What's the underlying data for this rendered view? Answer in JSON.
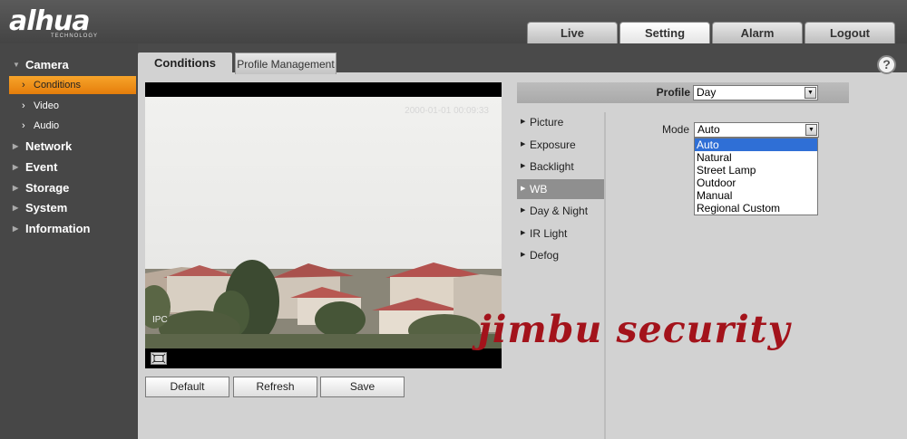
{
  "brand": {
    "name": "alhua",
    "sub": "TECHNOLOGY"
  },
  "topnav": {
    "tabs": [
      {
        "label": "Live"
      },
      {
        "label": "Setting"
      },
      {
        "label": "Alarm"
      },
      {
        "label": "Logout"
      }
    ],
    "active": "Setting"
  },
  "sidebar": {
    "camera": "Camera",
    "camera_items": [
      {
        "label": "Conditions"
      },
      {
        "label": "Video"
      },
      {
        "label": "Audio"
      }
    ],
    "sections": [
      {
        "label": "Network"
      },
      {
        "label": "Event"
      },
      {
        "label": "Storage"
      },
      {
        "label": "System"
      },
      {
        "label": "Information"
      }
    ]
  },
  "subtabs": {
    "active": "Conditions",
    "other": "Profile Management"
  },
  "help": "?",
  "video": {
    "timestamp": "2000-01-01 00:09:33",
    "osd": "IPC"
  },
  "buttons": {
    "default": "Default",
    "refresh": "Refresh",
    "save": "Save"
  },
  "profile": {
    "label": "Profile",
    "value": "Day"
  },
  "menu": {
    "items": [
      {
        "label": "Picture"
      },
      {
        "label": "Exposure"
      },
      {
        "label": "Backlight"
      },
      {
        "label": "WB"
      },
      {
        "label": "Day & Night"
      },
      {
        "label": "IR Light"
      },
      {
        "label": "Defog"
      }
    ],
    "active": "WB"
  },
  "mode": {
    "label": "Mode",
    "value": "Auto",
    "options": [
      "Auto",
      "Natural",
      "Street Lamp",
      "Outdoor",
      "Manual",
      "Regional Custom"
    ]
  },
  "watermark": "jimbu security",
  "icons": {
    "fullscreen": "fullscreen-icon",
    "help": "help-icon",
    "dropdown": "chevron-down-icon"
  },
  "colors": {
    "accent": "#f29418",
    "menu_active": "#8f8f8f",
    "watermark": "#a3131b",
    "select_highlight": "#2f6fd6"
  }
}
